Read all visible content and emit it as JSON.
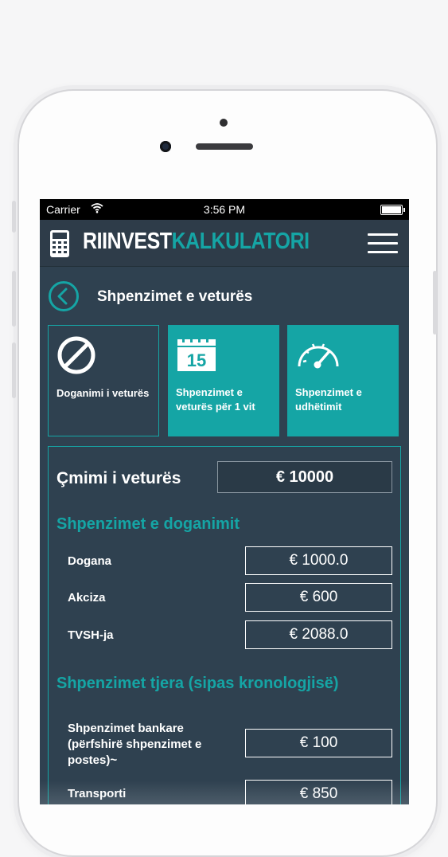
{
  "status_bar": {
    "carrier": "Carrier",
    "time": "3:56 PM"
  },
  "app_bar": {
    "brand_primary": "RIINVEST",
    "brand_secondary": "KALKULATORI"
  },
  "page": {
    "title": "Shpenzimet e veturës"
  },
  "tiles": [
    {
      "label": "Doganimi i veturës",
      "icon": "block-icon"
    },
    {
      "label": "Shpenzimet e veturës për 1 vit",
      "icon": "calendar-icon",
      "calendar_day": "15"
    },
    {
      "label": "Shpenzimet e udhëtimit",
      "icon": "speedometer-icon"
    }
  ],
  "price": {
    "label": "Çmimi i veturës",
    "value": "€ 10000"
  },
  "customs_section": {
    "title": "Shpenzimet e doganimit",
    "rows": [
      {
        "label": "Dogana",
        "value": "€ 1000.0"
      },
      {
        "label": "Akciza",
        "value": "€ 600"
      },
      {
        "label": "TVSH-ja",
        "value": "€ 2088.0"
      }
    ]
  },
  "other_section": {
    "title": "Shpenzimet tjera (sipas kronologjisë)",
    "rows": [
      {
        "label": "Shpenzimet bankare (përfshirë shpenzimet e postes)~",
        "value": "€ 100"
      },
      {
        "label": "Transporti",
        "value": "€ 850"
      }
    ]
  },
  "colors": {
    "accent": "#15a5a5",
    "background": "#2f4150",
    "app_bar": "#2e3c49"
  }
}
